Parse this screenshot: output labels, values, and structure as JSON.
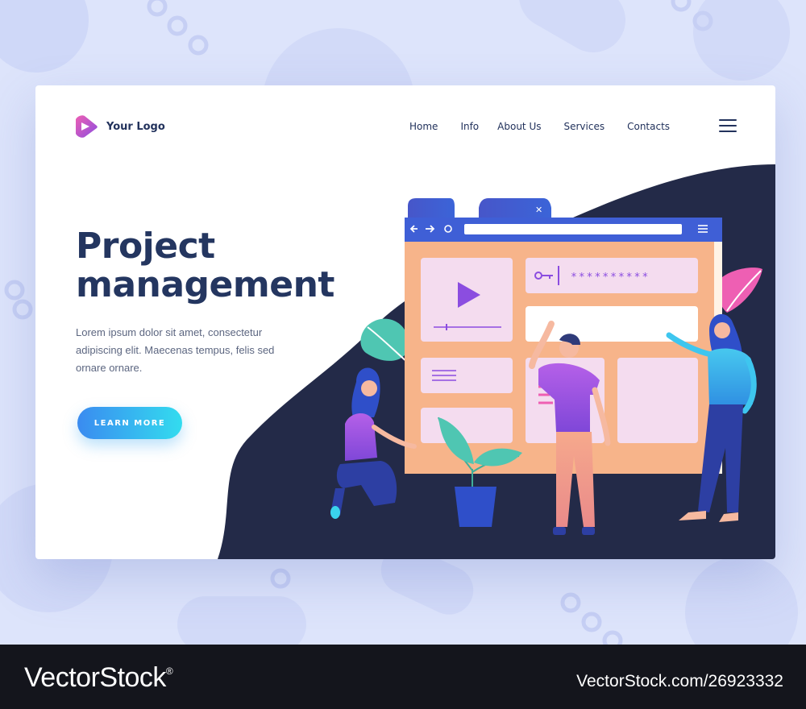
{
  "logo": {
    "text": "Your Logo",
    "icon": "logo-triangle-icon"
  },
  "nav": {
    "items": [
      "Home",
      "Info",
      "About Us",
      "Services",
      "Contacts"
    ],
    "menu_icon": "hamburger-menu-icon"
  },
  "hero": {
    "title_line1": "Project",
    "title_line2": "management",
    "description": "Lorem ipsum dolor sit amet, consectetur adipiscing elit. Maecenas tempus, felis sed ornare ornare.",
    "cta_label": "LEARN MORE"
  },
  "illustration": {
    "password_mask": "**********",
    "icons": [
      "play-icon",
      "key-icon",
      "back-arrow-icon",
      "forward-arrow-icon",
      "refresh-icon",
      "close-icon",
      "menu-icon",
      "plant-icon"
    ]
  },
  "footer": {
    "brand": "VectorStock",
    "trademark": "®",
    "image_id": "VectorStock.com/26923332"
  },
  "colors": {
    "navy": "#243660",
    "dark_wave": "#232a48",
    "accent_purple": "#8b4de0",
    "accent_blue": "#3a8bf0",
    "accent_cyan": "#33dcef",
    "panel_peach": "#f7b48a",
    "panel_pink": "#f4dcef"
  }
}
